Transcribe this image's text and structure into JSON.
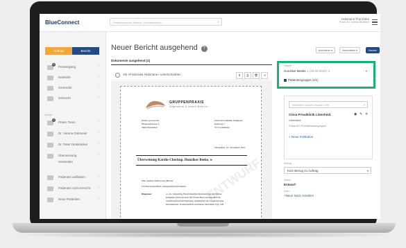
{
  "app": {
    "name": "BlueConnect"
  },
  "search": {
    "placeholder": "Patientensuche (Name, Geburtsdatum)"
  },
  "user": {
    "name": "Hubmann Franziska",
    "subtitle": "Praxis Dr. Verena Birkmeier"
  },
  "sidebar": {
    "segment": {
      "left": "Auftrag",
      "right": "Bericht"
    },
    "items": [
      {
        "label": "Posteingang",
        "badge": "3"
      },
      {
        "label": "Entwürfe"
      },
      {
        "label": "Gesendet"
      },
      {
        "label": "Gelöscht"
      }
    ],
    "section_label": "Ordner",
    "folders": [
      {
        "label": "Praxis Team",
        "badge": "1"
      },
      {
        "label": "Dr. Verena Dirkmeier"
      },
      {
        "label": "Dr. Peter Dinkelacker"
      },
      {
        "label": "Überweisung"
      },
      {
        "label": "versenden"
      },
      {
        "label": "Patienten aufbieten"
      },
      {
        "label": "Patienten nicht erreicht"
      },
      {
        "label": "Neue Patienten"
      }
    ]
  },
  "main": {
    "title": "Neuer Bericht ausgehend",
    "toolbar": {
      "archive": "Archivieren ▾",
      "more": "Verschieben ▾",
      "send": "Senden"
    },
    "documents_label": "Dokumente ausgehend (1)",
    "sign_label": "Als «Franziska Hubmann» unterschreiben",
    "doc_tools": [
      "⬇",
      "⎙",
      "🗑",
      "⇥"
    ]
  },
  "letter": {
    "practice": "GRUPPENPRAXIS",
    "practice_sub": "Allgemeine & Innere Medizin",
    "sender": [
      "Praxis Grosswald",
      "Pflanzeldstrasse 3",
      "3400 Winterthur"
    ],
    "recipient": [
      "Clinia Privatklinik Limmatal",
      "Kittlweg 1",
      "3715 Limmatal"
    ],
    "date": "Winterthur, 27. November 2021",
    "subject": "Überweisung Kardio-Checkup, Hunziker Beeke, w",
    "greeting": "Sehr geehrte Damen und Herren",
    "body": "Ich überweise Ihnen obengenannten Patientin.",
    "diagnosis_label": "Diagnose:",
    "diagnosis_lines": [
      "ca. Ab., Zustandbag. Besttromhohlgar hipsiziekal oder psychisches",
      "Komplikat (durch den Arzt) TE). Ersten Hypovorposten durch Itu",
      "rauermasonsbetersrtk Hypnatang, zunehmende iche Joergelruterorme",
      "Drucksnebrsler, Verunsichunliche anordinerte Umwellshie (Vgl. VaH"
    ],
    "watermark": "ENTWURF"
  },
  "right_panel": {
    "patient_label": "Patient",
    "patient": "Hunziker Beeke",
    "patient_dob": "1 (28.09.2001)",
    "gender_icon": "♀",
    "checkbox_label": "Patientengruppe (1/1)",
    "institution_search": "Institution suchen (Name, Ort)",
    "institution_name": "Clinia Privatklinik Littenheid.",
    "institution_city": "Littenheid",
    "institution_group": "Clinia AG Privatkliniken­gruppe",
    "new_institution": "Neue Institution",
    "order_label": "Auftrag",
    "order_value": "Kein Bezug zu Auftrag",
    "status_label": "Status",
    "status_value": "Entwurf",
    "note_label": "Notiz",
    "new_note": "Neue Notiz erstellen"
  },
  "colors": {
    "brand": "#234a82",
    "accent": "#f2a53a",
    "highlight": "#17b471"
  }
}
